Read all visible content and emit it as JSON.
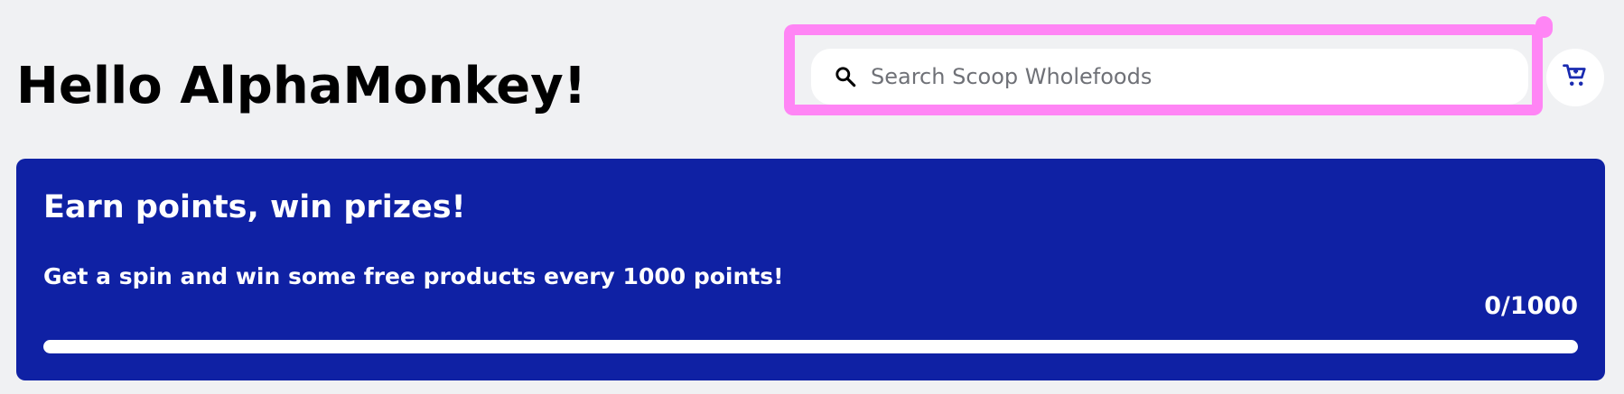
{
  "header": {
    "greeting": "Hello AlphaMonkey!"
  },
  "search": {
    "placeholder": "Search Scoop Wholefoods",
    "value": "",
    "icon": "search-icon"
  },
  "cart": {
    "icon": "cart-icon",
    "accent_color": "#1a2bb0"
  },
  "promo": {
    "title": "Earn points, win prizes!",
    "description": "Get a spin and win some free products every 1000 points!",
    "points_display": "0/1000",
    "points_current": 0,
    "points_goal": 1000,
    "progress_fraction": 0,
    "background_color": "#0f21a4"
  },
  "annotation": {
    "color": "#ff85f5"
  }
}
